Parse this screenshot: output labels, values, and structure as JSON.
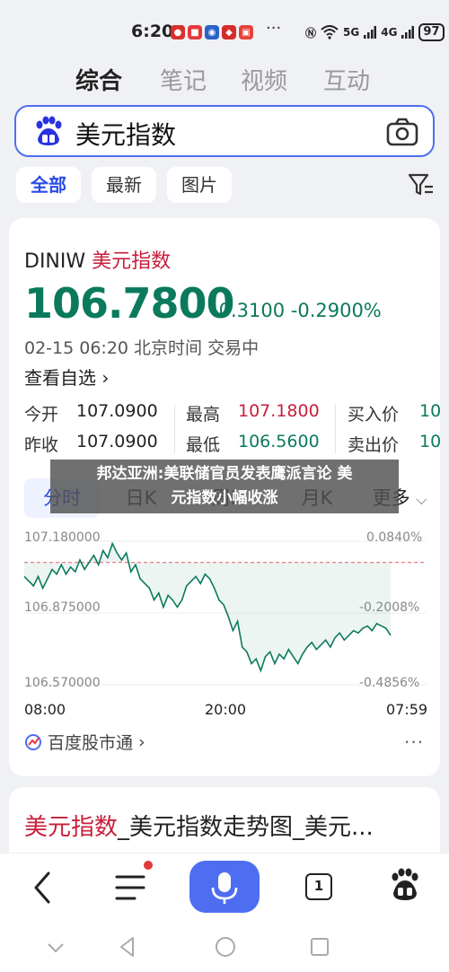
{
  "status": {
    "time": "6:20",
    "more": "···",
    "network_5g": "5G",
    "network_4g": "4G",
    "battery": "97"
  },
  "tabs": [
    "综合",
    "笔记",
    "视频",
    "互动"
  ],
  "search": {
    "query": "美元指数"
  },
  "filters": [
    "全部",
    "最新",
    "图片"
  ],
  "quote": {
    "code": "DINIW",
    "name": "美元指数",
    "price": "106.7800",
    "change": "-0.3100",
    "change_pct": "-0.2900%",
    "datetime": "02-15 06:20 北京时间 交易中",
    "watch_label": "查看自选",
    "stats": [
      {
        "label": "今开",
        "value": "107.0900",
        "color": "#222222"
      },
      {
        "label": "最高",
        "value": "107.1800",
        "color": "#c81e3a"
      },
      {
        "label": "买入价",
        "value": "10",
        "color": "#0b7a5c"
      },
      {
        "label": "昨收",
        "value": "107.0900",
        "color": "#222222"
      },
      {
        "label": "最低",
        "value": "106.5600",
        "color": "#0b7a5c"
      },
      {
        "label": "卖出价",
        "value": "10",
        "color": "#0b7a5c"
      }
    ]
  },
  "chart_tabs": [
    "分时",
    "日K",
    "周K",
    "月K",
    "更多"
  ],
  "banner": {
    "line1": "邦达亚洲:美联储官员发表鹰派言论 美",
    "line2": "元指数小幅收涨"
  },
  "chart_data": {
    "type": "line",
    "y_left_labels": [
      "107.180000",
      "106.875000",
      "106.570000"
    ],
    "y_right_labels": [
      "0.0840%",
      "-0.2008%",
      "-0.4856%"
    ],
    "x_labels": [
      "08:00",
      "20:00",
      "07:59"
    ],
    "reference": 107.09,
    "ylim": [
      106.57,
      107.18
    ],
    "colors": {
      "line": "#0b7a5c",
      "down_fill": "#0b7a5c",
      "up_fill": "#c81e3a",
      "reference": "#e57f85"
    },
    "series": [
      {
        "values": [
          107.03,
          107.01,
          106.99,
          107.03,
          106.98,
          107.02,
          107.06,
          107.04,
          107.08,
          107.04,
          107.07,
          107.05,
          107.1,
          107.06,
          107.09,
          107.12,
          107.08,
          107.14,
          107.11,
          107.17,
          107.13,
          107.1,
          107.13,
          107.05,
          107.08,
          107.02,
          107.0,
          106.98,
          106.93,
          106.96,
          106.9,
          106.95,
          106.93,
          106.9,
          106.93,
          106.99,
          107.01,
          107.03,
          107.0,
          107.04,
          107.02,
          106.98,
          106.93,
          106.91,
          106.86,
          106.8,
          106.84,
          106.73,
          106.71,
          106.66,
          106.68,
          106.63,
          106.69,
          106.71,
          106.66,
          106.7,
          106.68,
          106.72,
          106.69,
          106.66,
          106.7,
          106.73,
          106.75,
          106.72,
          106.74,
          106.76,
          106.73,
          106.77,
          106.79,
          106.76,
          106.78,
          106.8,
          106.79,
          106.81,
          106.82,
          106.8,
          106.83,
          106.82,
          106.81,
          106.78
        ]
      }
    ]
  },
  "source": {
    "label": "百度股市通",
    "more": "···"
  },
  "result2": {
    "highlight": "美元指数",
    "rest": "_美元指数走势图_美元..."
  },
  "bottom": {
    "tab_count": "1"
  }
}
